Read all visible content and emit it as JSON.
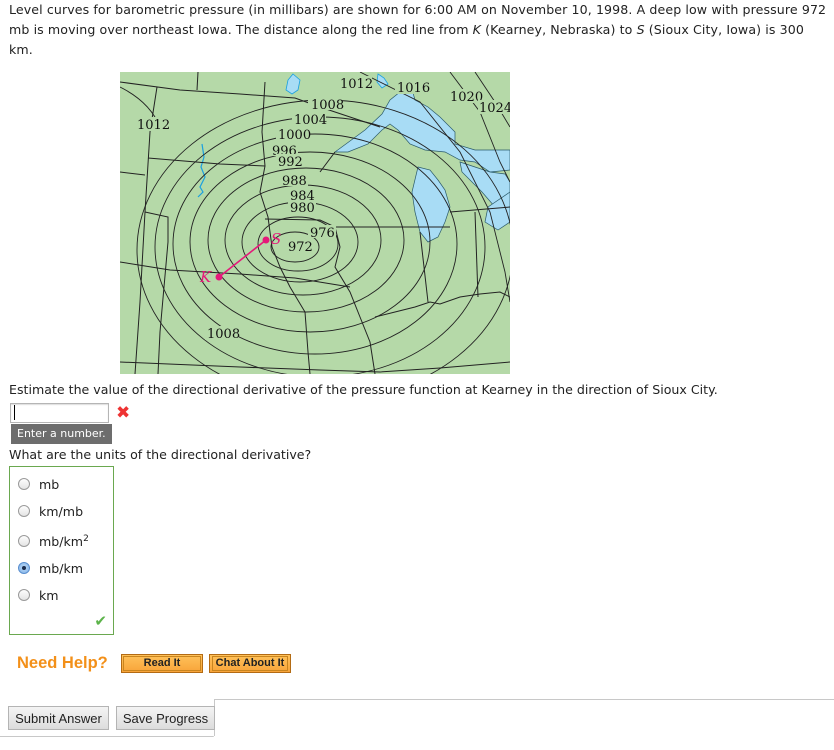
{
  "problem": {
    "intro_part1": "Level curves for barometric pressure (in millibars) are shown for 6:00 AM on November 10, 1998. A deep low with pressure 972 mb is moving over northeast Iowa. The distance along the red line from ",
    "k_label": "K",
    "intro_part2": " (Kearney, Nebraska) to ",
    "s_label": "S",
    "intro_part3": " (Sioux City, Iowa) is 300 km."
  },
  "map": {
    "contour_labels": [
      "1012",
      "1016",
      "1020",
      "1024",
      "1008",
      "1004",
      "1000",
      "996",
      "992",
      "988",
      "984",
      "980",
      "976",
      "972",
      "1012",
      "1008"
    ],
    "point_k": "K",
    "point_s": "S",
    "colors": {
      "land": "#b5d9a8",
      "water": "#a8dcf5",
      "route": "#e5197a",
      "lines": "#222222"
    }
  },
  "part1": {
    "question": "Estimate the value of the directional derivative of the pressure function at Kearney in the direction of Sioux City.",
    "input_value": "",
    "status_icon": "incorrect-x",
    "hint": "Enter a number."
  },
  "part2": {
    "question": "What are the units of the directional derivative?",
    "options": [
      {
        "label": "mb",
        "sup": "",
        "checked": false
      },
      {
        "label": "km/mb",
        "sup": "",
        "checked": false
      },
      {
        "label": "mb/km",
        "sup": "2",
        "checked": false
      },
      {
        "label": "mb/km",
        "sup": "",
        "checked": true
      },
      {
        "label": "km",
        "sup": "",
        "checked": false
      }
    ],
    "status_icon": "correct-check"
  },
  "help": {
    "label": "Need Help?",
    "read_it": "Read It",
    "chat_about_it": "Chat About It"
  },
  "actions": {
    "submit": "Submit Answer",
    "save": "Save Progress"
  }
}
